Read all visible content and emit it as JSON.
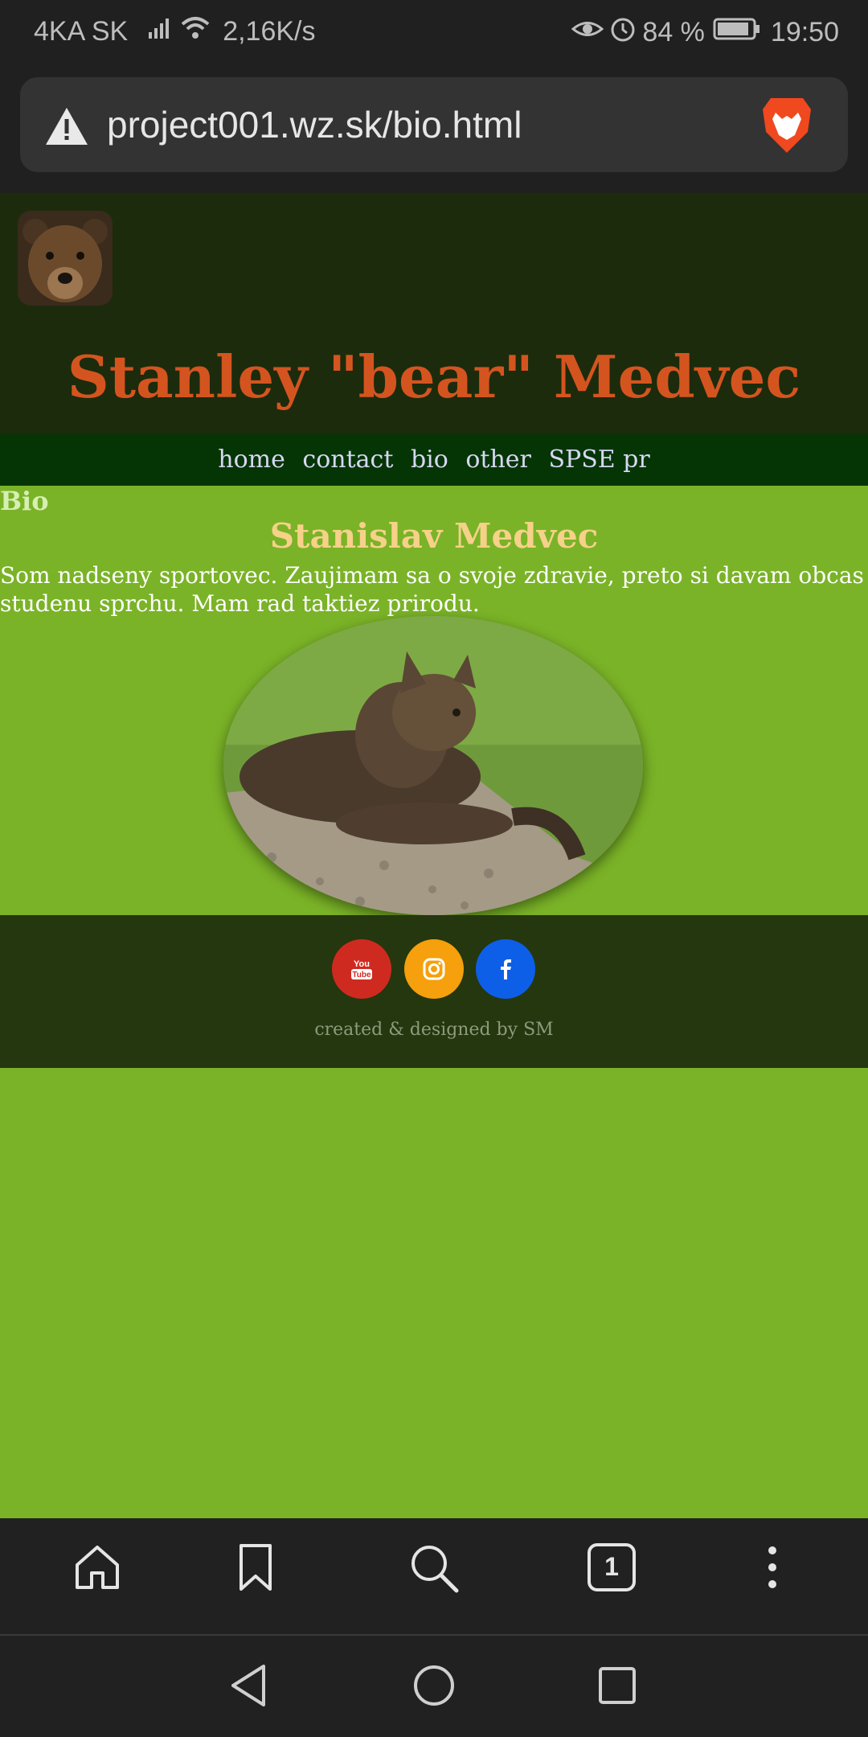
{
  "status_bar": {
    "carrier": "4KA SK",
    "speed": "2,16K/s",
    "battery": "84 %",
    "time": "19:50",
    "icons": [
      "signal-icon",
      "wifi-icon",
      "eye-icon",
      "alarm-icon",
      "battery-icon"
    ]
  },
  "browser": {
    "url": "project001.wz.sk/bio.html",
    "tab_count": "1",
    "icons": [
      "warning-icon",
      "brave-icon",
      "home-icon",
      "bookmark-icon",
      "search-icon",
      "tabs-icon",
      "more-icon"
    ]
  },
  "site": {
    "title": "Stanley \"bear\" Medvec",
    "nav": [
      "home",
      "contact",
      "bio",
      "other",
      "SPSE pr"
    ],
    "section_label": "Bio",
    "subtitle": "Stanislav Medvec",
    "paragraph": "Som nadseny sportovec. Zaujimam sa o svoje zdravie, preto si davam obcas studenu sprchu. Mam rad taktiez prirodu.",
    "credit": "created & designed by SM",
    "social": [
      "youtube-icon",
      "instagram-icon",
      "facebook-icon"
    ]
  },
  "colors": {
    "page_bg": "#7ab327",
    "header_bg": "#1c2b0c",
    "nav_bg": "#053505",
    "footer_bg": "#25370e",
    "title": "#d4541f",
    "subtitle": "#f6d18a",
    "youtube": "#cf2a20",
    "instagram": "#f5a00c",
    "facebook": "#0e5fe8"
  }
}
